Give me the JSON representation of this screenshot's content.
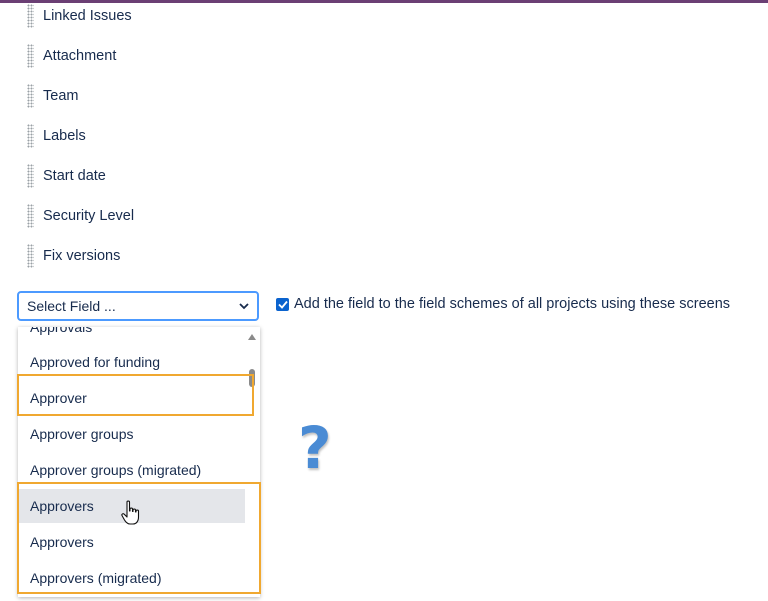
{
  "fields": [
    {
      "name": "field-linked-issues",
      "label": "Linked Issues"
    },
    {
      "name": "field-attachment",
      "label": "Attachment"
    },
    {
      "name": "field-team",
      "label": "Team"
    },
    {
      "name": "field-labels",
      "label": "Labels"
    },
    {
      "name": "field-start-date",
      "label": "Start date"
    },
    {
      "name": "field-security-level",
      "label": "Security Level"
    },
    {
      "name": "field-fix-versions",
      "label": "Fix versions"
    }
  ],
  "select": {
    "value": "Select Field ...",
    "checkbox_label": "Add the field to the field schemes of all projects using these screens",
    "checkbox_checked": true
  },
  "dropdown": {
    "cut_item": "Approvals",
    "items": [
      {
        "label": "Approved for funding"
      },
      {
        "label": "Approver"
      },
      {
        "label": "Approver groups"
      },
      {
        "label": "Approver groups (migrated)"
      },
      {
        "label": "Approvers"
      },
      {
        "label": "Approvers"
      },
      {
        "label": "Approvers (migrated)"
      }
    ]
  },
  "colors": {
    "accent": "#4c9aff",
    "highlight": "#f0a830",
    "top_bar": "#6b3f74"
  },
  "icons": {
    "question": "?"
  }
}
